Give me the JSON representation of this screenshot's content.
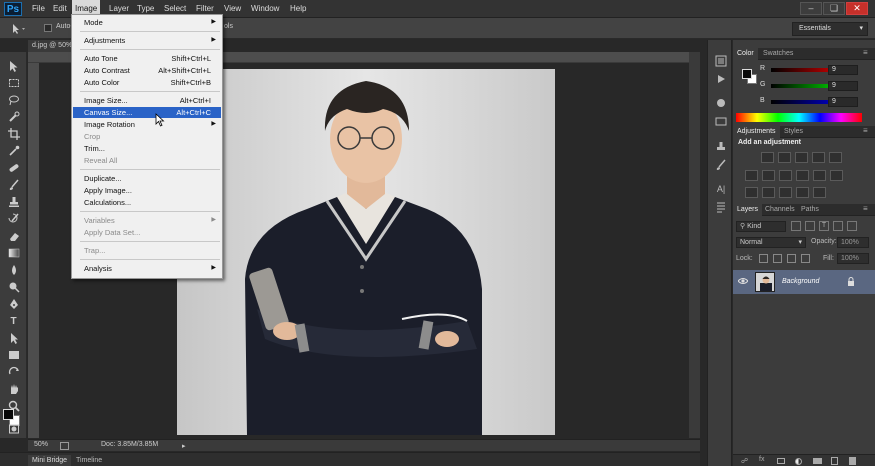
{
  "app": {
    "logo": "Ps",
    "accent": "#2fa3f5"
  },
  "menubar": {
    "items": [
      "File",
      "Edit",
      "Image",
      "Layer",
      "Type",
      "Select",
      "Filter",
      "View",
      "Window",
      "Help"
    ],
    "active": "Image",
    "window_buttons": [
      "minimize",
      "restore",
      "close"
    ]
  },
  "options_bar": {
    "auto_select_label": "Auto-",
    "extra_label": "ols",
    "workspace": "Essentials"
  },
  "document": {
    "tab_title": "d.jpg @ 50%",
    "zoom": "50%",
    "doc_info": "Doc: 3.85M/3.85M"
  },
  "image_menu": {
    "items": [
      {
        "label": "Mode",
        "submenu": true,
        "sep_after": true
      },
      {
        "label": "Adjustments",
        "submenu": true,
        "sep_after": true
      },
      {
        "label": "Auto Tone",
        "shortcut": "Shift+Ctrl+L"
      },
      {
        "label": "Auto Contrast",
        "shortcut": "Alt+Shift+Ctrl+L"
      },
      {
        "label": "Auto Color",
        "shortcut": "Shift+Ctrl+B",
        "sep_after": true
      },
      {
        "label": "Image Size...",
        "shortcut": "Alt+Ctrl+I"
      },
      {
        "label": "Canvas Size...",
        "shortcut": "Alt+Ctrl+C",
        "highlighted": true
      },
      {
        "label": "Image Rotation",
        "submenu": true
      },
      {
        "label": "Crop",
        "disabled": true
      },
      {
        "label": "Trim..."
      },
      {
        "label": "Reveal All",
        "disabled": true,
        "sep_after": true
      },
      {
        "label": "Duplicate..."
      },
      {
        "label": "Apply Image..."
      },
      {
        "label": "Calculations...",
        "sep_after": true
      },
      {
        "label": "Variables",
        "submenu": true,
        "disabled": true
      },
      {
        "label": "Apply Data Set...",
        "disabled": true,
        "sep_after": true
      },
      {
        "label": "Trap...",
        "disabled": true,
        "sep_after": true
      },
      {
        "label": "Analysis",
        "submenu": true
      }
    ]
  },
  "color_panel": {
    "tabs": [
      "Color",
      "Swatches"
    ],
    "channels": [
      {
        "label": "R",
        "value": "9"
      },
      {
        "label": "G",
        "value": "9"
      },
      {
        "label": "B",
        "value": "9"
      }
    ],
    "foreground": "#090909",
    "background": "#ffffff"
  },
  "adjustments_panel": {
    "tabs": [
      "Adjustments",
      "Styles"
    ],
    "heading": "Add an adjustment"
  },
  "layers_panel": {
    "tabs": [
      "Layers",
      "Channels",
      "Paths"
    ],
    "filter_label": "Kind",
    "blend_mode": "Normal",
    "opacity_label": "Opacity:",
    "opacity_value": "100%",
    "lock_label": "Lock:",
    "fill_label": "Fill:",
    "fill_value": "100%",
    "layers": [
      {
        "name": "Background",
        "visible": true,
        "locked": true
      }
    ]
  },
  "bottom_tabs": [
    "Mini Bridge",
    "Timeline"
  ]
}
